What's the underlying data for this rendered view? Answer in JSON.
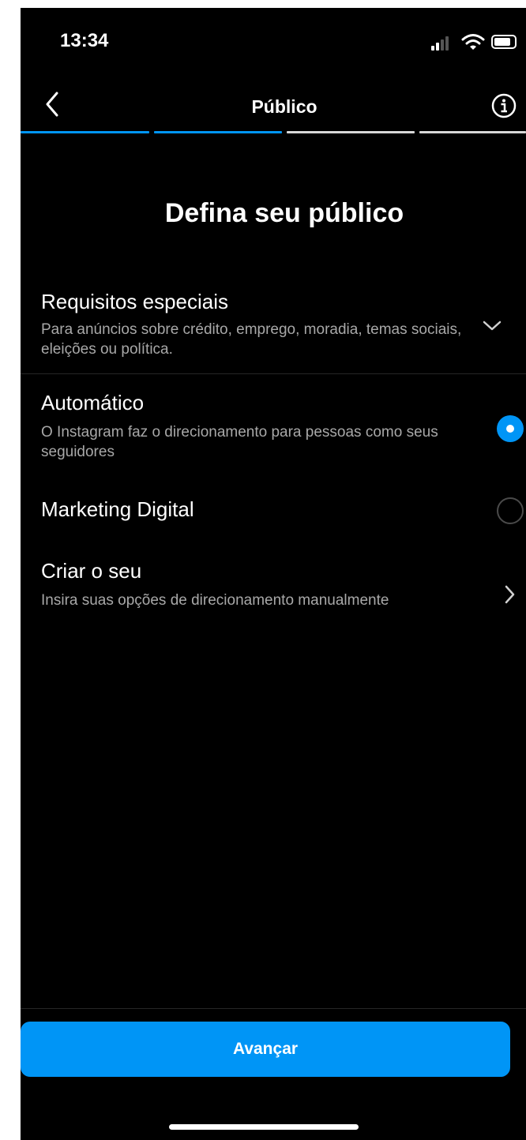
{
  "status_bar": {
    "time": "13:34"
  },
  "nav": {
    "title": "Público",
    "progress_steps_done": 2,
    "progress_steps_total": 4
  },
  "main": {
    "heading": "Defina seu público"
  },
  "special_requirements": {
    "title": "Requisitos especiais",
    "subtitle": "Para anúncios sobre crédito, emprego, moradia, temas sociais, eleições ou política."
  },
  "audience_options": [
    {
      "title": "Automático",
      "subtitle": "O Instagram faz o direcionamento para pessoas como seus seguidores",
      "selected": true
    },
    {
      "title": "Marketing Digital",
      "subtitle": "",
      "selected": false
    }
  ],
  "create_own": {
    "title": "Criar o seu",
    "subtitle": "Insira suas opções de direcionamento manualmente"
  },
  "footer": {
    "next_label": "Avançar"
  },
  "colors": {
    "accent": "#0095f6",
    "background": "#000000",
    "secondary_text": "#a8a8a8",
    "divider": "#262626"
  },
  "icons": [
    "back-chevron-icon",
    "info-icon",
    "chevron-down-icon",
    "chevron-right-icon",
    "signal-icon",
    "wifi-icon",
    "battery-icon"
  ]
}
